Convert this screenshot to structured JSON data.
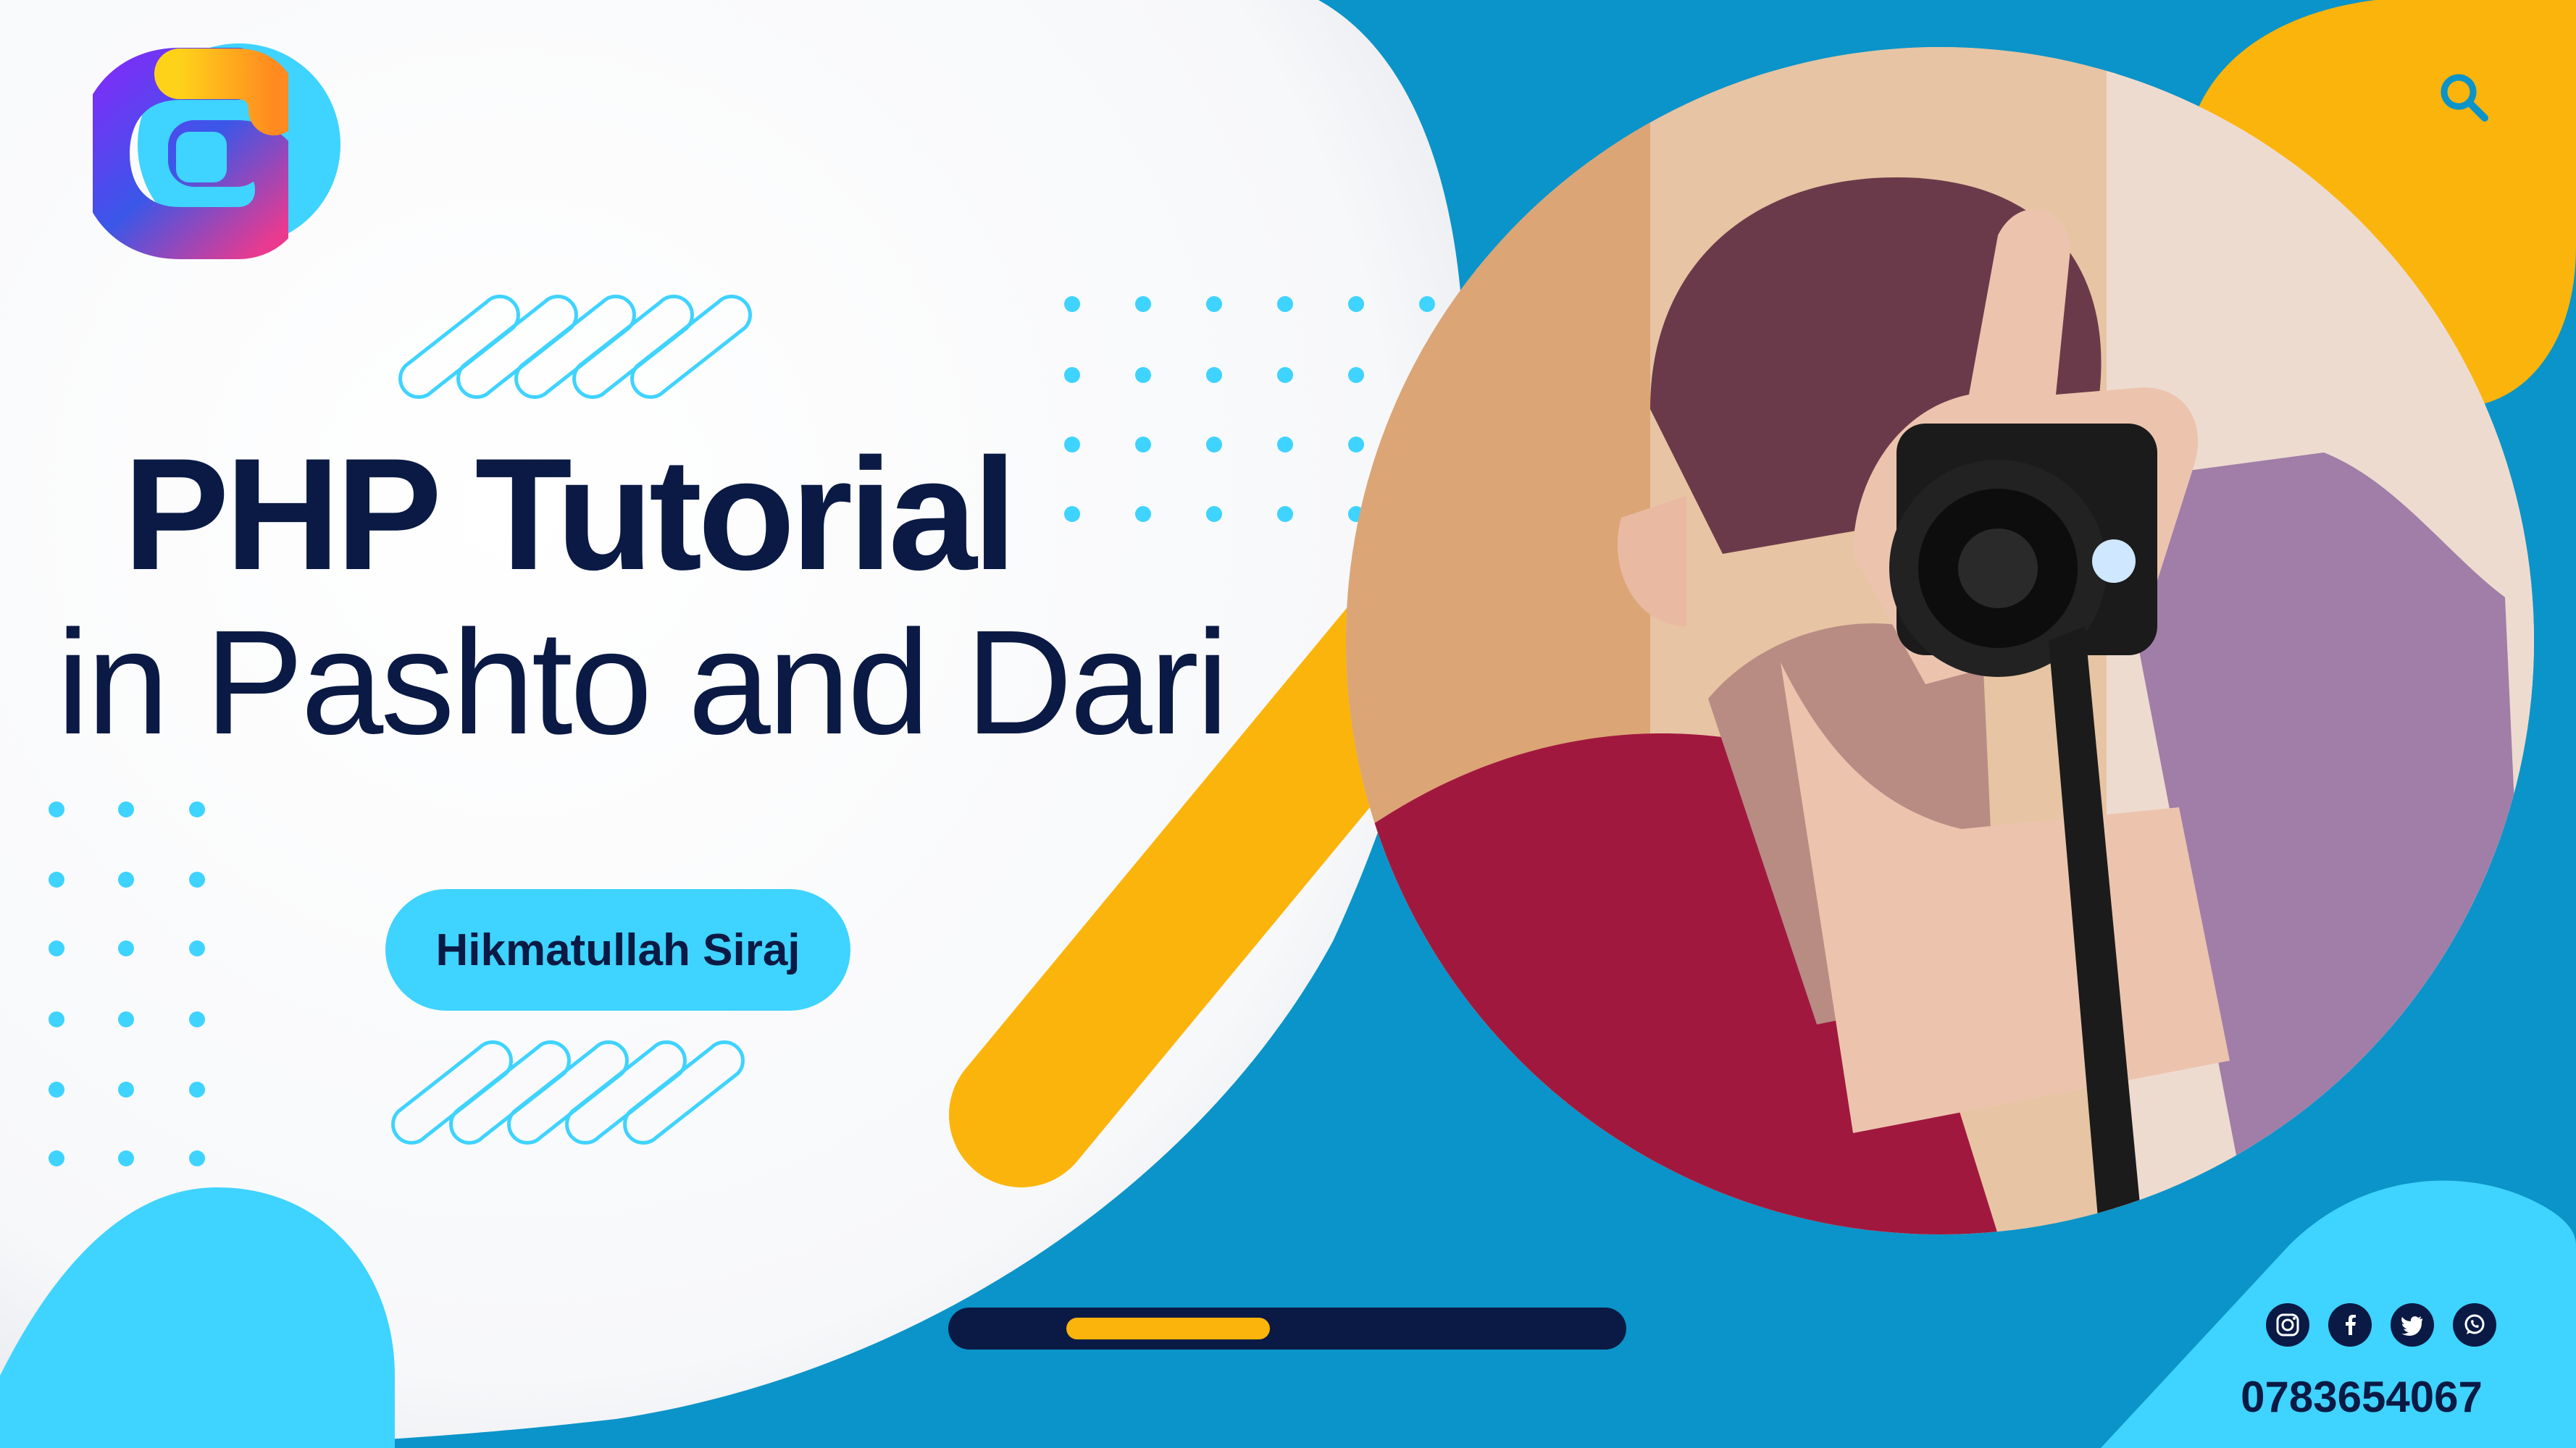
{
  "title": {
    "line1": "PHP Tutorial",
    "line2": "in Pashto and Dari"
  },
  "author": "Hikmatullah Siraj",
  "phone": "0783654067",
  "progress": 0.3,
  "icons": {
    "logo": "c-logo-icon",
    "search": "search-icon",
    "social": [
      "instagram-icon",
      "facebook-icon",
      "twitter-icon",
      "whatsapp-icon"
    ]
  },
  "colors": {
    "navy": "#0a1a44",
    "cyan": "#3fd3ff",
    "blue": "#0a94c9",
    "yellow": "#fbb40b",
    "white": "#ffffff"
  }
}
